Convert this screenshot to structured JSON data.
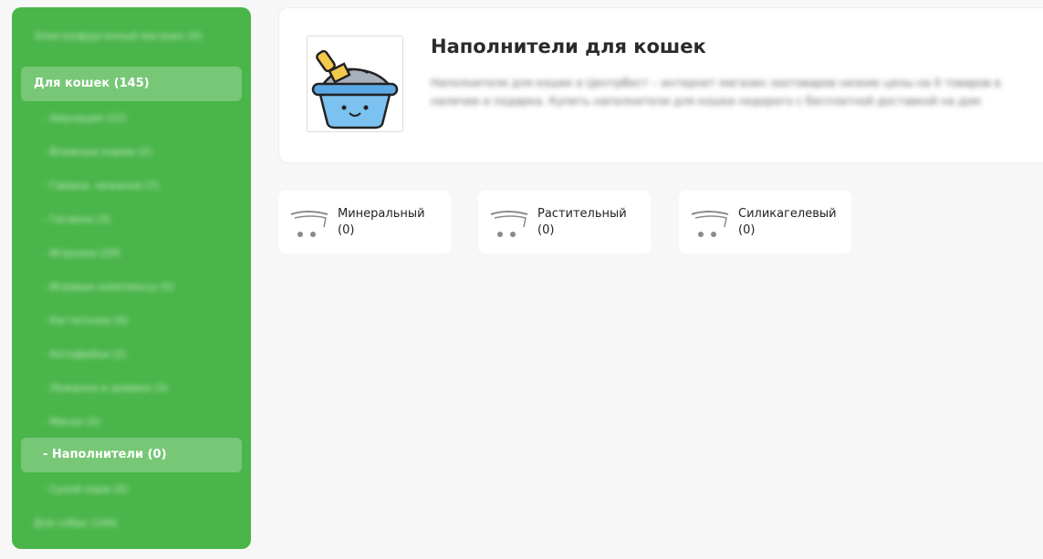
{
  "sidebar": {
    "items": [
      {
        "label": "Электрофургонный магазин (0)",
        "blurred": true,
        "sub": false
      },
      {
        "label": "Для кошек (145)",
        "blurred": false,
        "sub": false,
        "active": true
      },
      {
        "label": "- Амуниция (12)",
        "blurred": true,
        "sub": true
      },
      {
        "label": "- Влажные корма (2)",
        "blurred": true,
        "sub": true
      },
      {
        "label": "- Гамаки, лежанки (7)",
        "blurred": true,
        "sub": true
      },
      {
        "label": "- Гигиена (3)",
        "blurred": true,
        "sub": true
      },
      {
        "label": "- Игрушки (20)",
        "blurred": true,
        "sub": true
      },
      {
        "label": "- Игровые комплексы (5)",
        "blurred": true,
        "sub": true
      },
      {
        "label": "- Когтеточки (0)",
        "blurred": true,
        "sub": true
      },
      {
        "label": "- Котофейки (2)",
        "blurred": true,
        "sub": true
      },
      {
        "label": "- Лежанки и домики (3)",
        "blurred": true,
        "sub": true
      },
      {
        "label": "- Миски (2)",
        "blurred": true,
        "sub": true
      },
      {
        "label": "- Наполнители (0)",
        "blurred": false,
        "sub": true,
        "active": true
      },
      {
        "label": "- Сухой корм (0)",
        "blurred": true,
        "sub": true
      },
      {
        "label": "Для собак (144)",
        "blurred": true,
        "sub": false
      }
    ]
  },
  "header": {
    "title": "Наполнители для кошек",
    "description": "Наполнители для кошек в ЦентрВест – интернет магазин зоотоваров низкие цены на 0 товаров в наличии и подарка. Купить наполнители для кошки недорого с бесплатной доставкой на дом",
    "image_icon": "litter-box-icon"
  },
  "tiles": [
    {
      "name": "Минеральный",
      "count": "(0)",
      "icon": "cart-icon"
    },
    {
      "name": "Растительный",
      "count": "(0)",
      "icon": "cart-icon"
    },
    {
      "name": "Силикагелевый",
      "count": "(0)",
      "icon": "cart-icon"
    }
  ],
  "colors": {
    "sidebar_bg": "#4ab54a",
    "page_bg": "#f7f7f7",
    "card_bg": "#ffffff"
  }
}
